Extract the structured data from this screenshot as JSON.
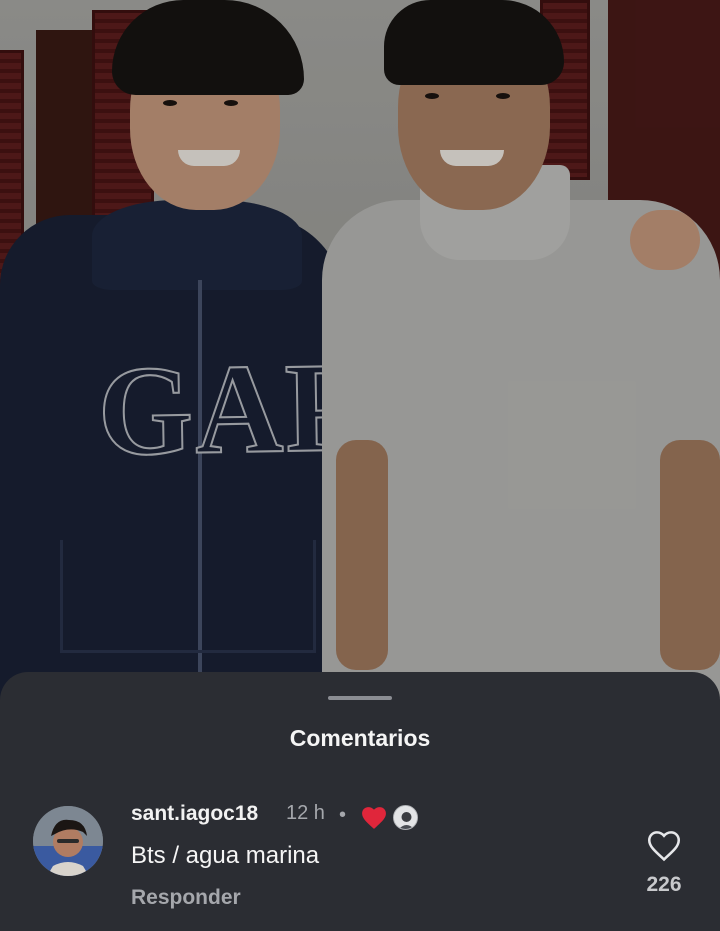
{
  "sheet": {
    "title": "Comentarios"
  },
  "comment": {
    "username": "sant.iagoc18",
    "time": "12 h",
    "separator": "•",
    "text": "Bts / agua marina",
    "reply_label": "Responder",
    "like_count": "226",
    "icons": {
      "creator_liked": "red-heart-icon",
      "like": "heart-outline-icon"
    }
  },
  "colors": {
    "sheet_bg": "#2b2d33",
    "heart_red": "#e0263b",
    "text_primary": "#f5f5f5",
    "text_secondary": "#a5a7ac"
  }
}
